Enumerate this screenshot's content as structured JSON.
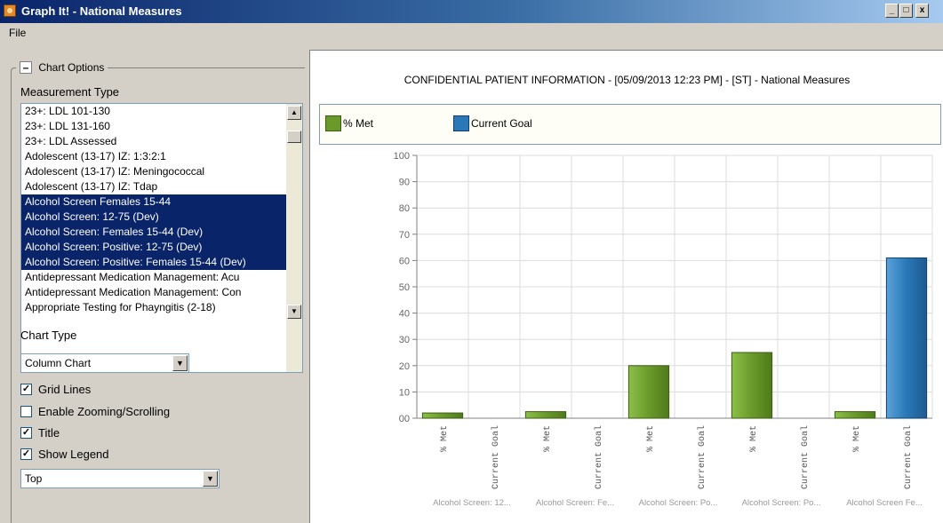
{
  "window": {
    "title": "Graph It! - National Measures",
    "minimize_label": "_",
    "restore_label": "□",
    "close_label": "x"
  },
  "menu": {
    "file_label": "File"
  },
  "chart_options": {
    "toggle_label": "–",
    "group_title": "Chart Options",
    "measurement_type_label": "Measurement Type",
    "measurement_list": [
      {
        "label": "23+: LDL 101-130",
        "selected": false
      },
      {
        "label": "23+: LDL 131-160",
        "selected": false
      },
      {
        "label": "23+: LDL Assessed",
        "selected": false
      },
      {
        "label": "Adolescent (13-17) IZ: 1:3:2:1",
        "selected": false
      },
      {
        "label": "Adolescent (13-17) IZ: Meningococcal",
        "selected": false
      },
      {
        "label": "Adolescent (13-17) IZ: Tdap",
        "selected": false
      },
      {
        "label": "Alcohol Screen Females 15-44",
        "selected": true
      },
      {
        "label": "Alcohol Screen: 12-75 (Dev)",
        "selected": true
      },
      {
        "label": "Alcohol Screen: Females 15-44 (Dev)",
        "selected": true
      },
      {
        "label": "Alcohol Screen: Positive: 12-75 (Dev)",
        "selected": true
      },
      {
        "label": "Alcohol Screen: Positive: Females 15-44 (Dev)",
        "selected": true
      },
      {
        "label": "Antidepressant Medication Management: Acu",
        "selected": false
      },
      {
        "label": "Antidepressant Medication Management: Con",
        "selected": false
      },
      {
        "label": "Appropriate Testing for Phayngitis (2-18)",
        "selected": false
      }
    ],
    "scroll_up_icon": "▲",
    "scroll_down_icon": "▼",
    "chart_type_label": "Chart Type",
    "chart_type_value": "Column Chart",
    "dropdown_icon": "▼",
    "grid_lines": {
      "label": "Grid Lines",
      "checked": true
    },
    "zooming": {
      "label": "Enable Zooming/Scrolling",
      "checked": false
    },
    "title_option": {
      "label": "Title",
      "checked": true
    },
    "show_legend": {
      "label": "Show Legend",
      "checked": true
    },
    "legend_position_value": "Top",
    "check_mark": "✓"
  },
  "chart": {
    "heading": "CONFIDENTIAL PATIENT INFORMATION - [05/09/2013 12:23 PM] - [ST] - National Measures",
    "legend": [
      {
        "label": "% Met",
        "color": "#6a9a2a"
      },
      {
        "label": "Current Goal",
        "color": "#2a78b8"
      }
    ]
  },
  "chart_data": {
    "type": "bar",
    "categories": [
      "Alcohol Screen: 12...",
      "Alcohol Screen: Fe...",
      "Alcohol Screen: Po...",
      "Alcohol Screen: Po...",
      "Alcohol Screen Fe..."
    ],
    "series": [
      {
        "name": "% Met",
        "values": [
          2,
          2.5,
          20,
          25,
          2.5
        ],
        "color": "#6a9a2a"
      },
      {
        "name": "Current Goal",
        "values": [
          0,
          0,
          0,
          0,
          61
        ],
        "color": "#2a78b8"
      }
    ],
    "bar_labels": [
      "% Met",
      "Current Goal"
    ],
    "ylim": [
      0,
      100
    ],
    "yticks": [
      "00",
      "10",
      "20",
      "30",
      "40",
      "50",
      "60",
      "70",
      "80",
      "90",
      "100"
    ],
    "grid": true,
    "legend_position": "top"
  }
}
